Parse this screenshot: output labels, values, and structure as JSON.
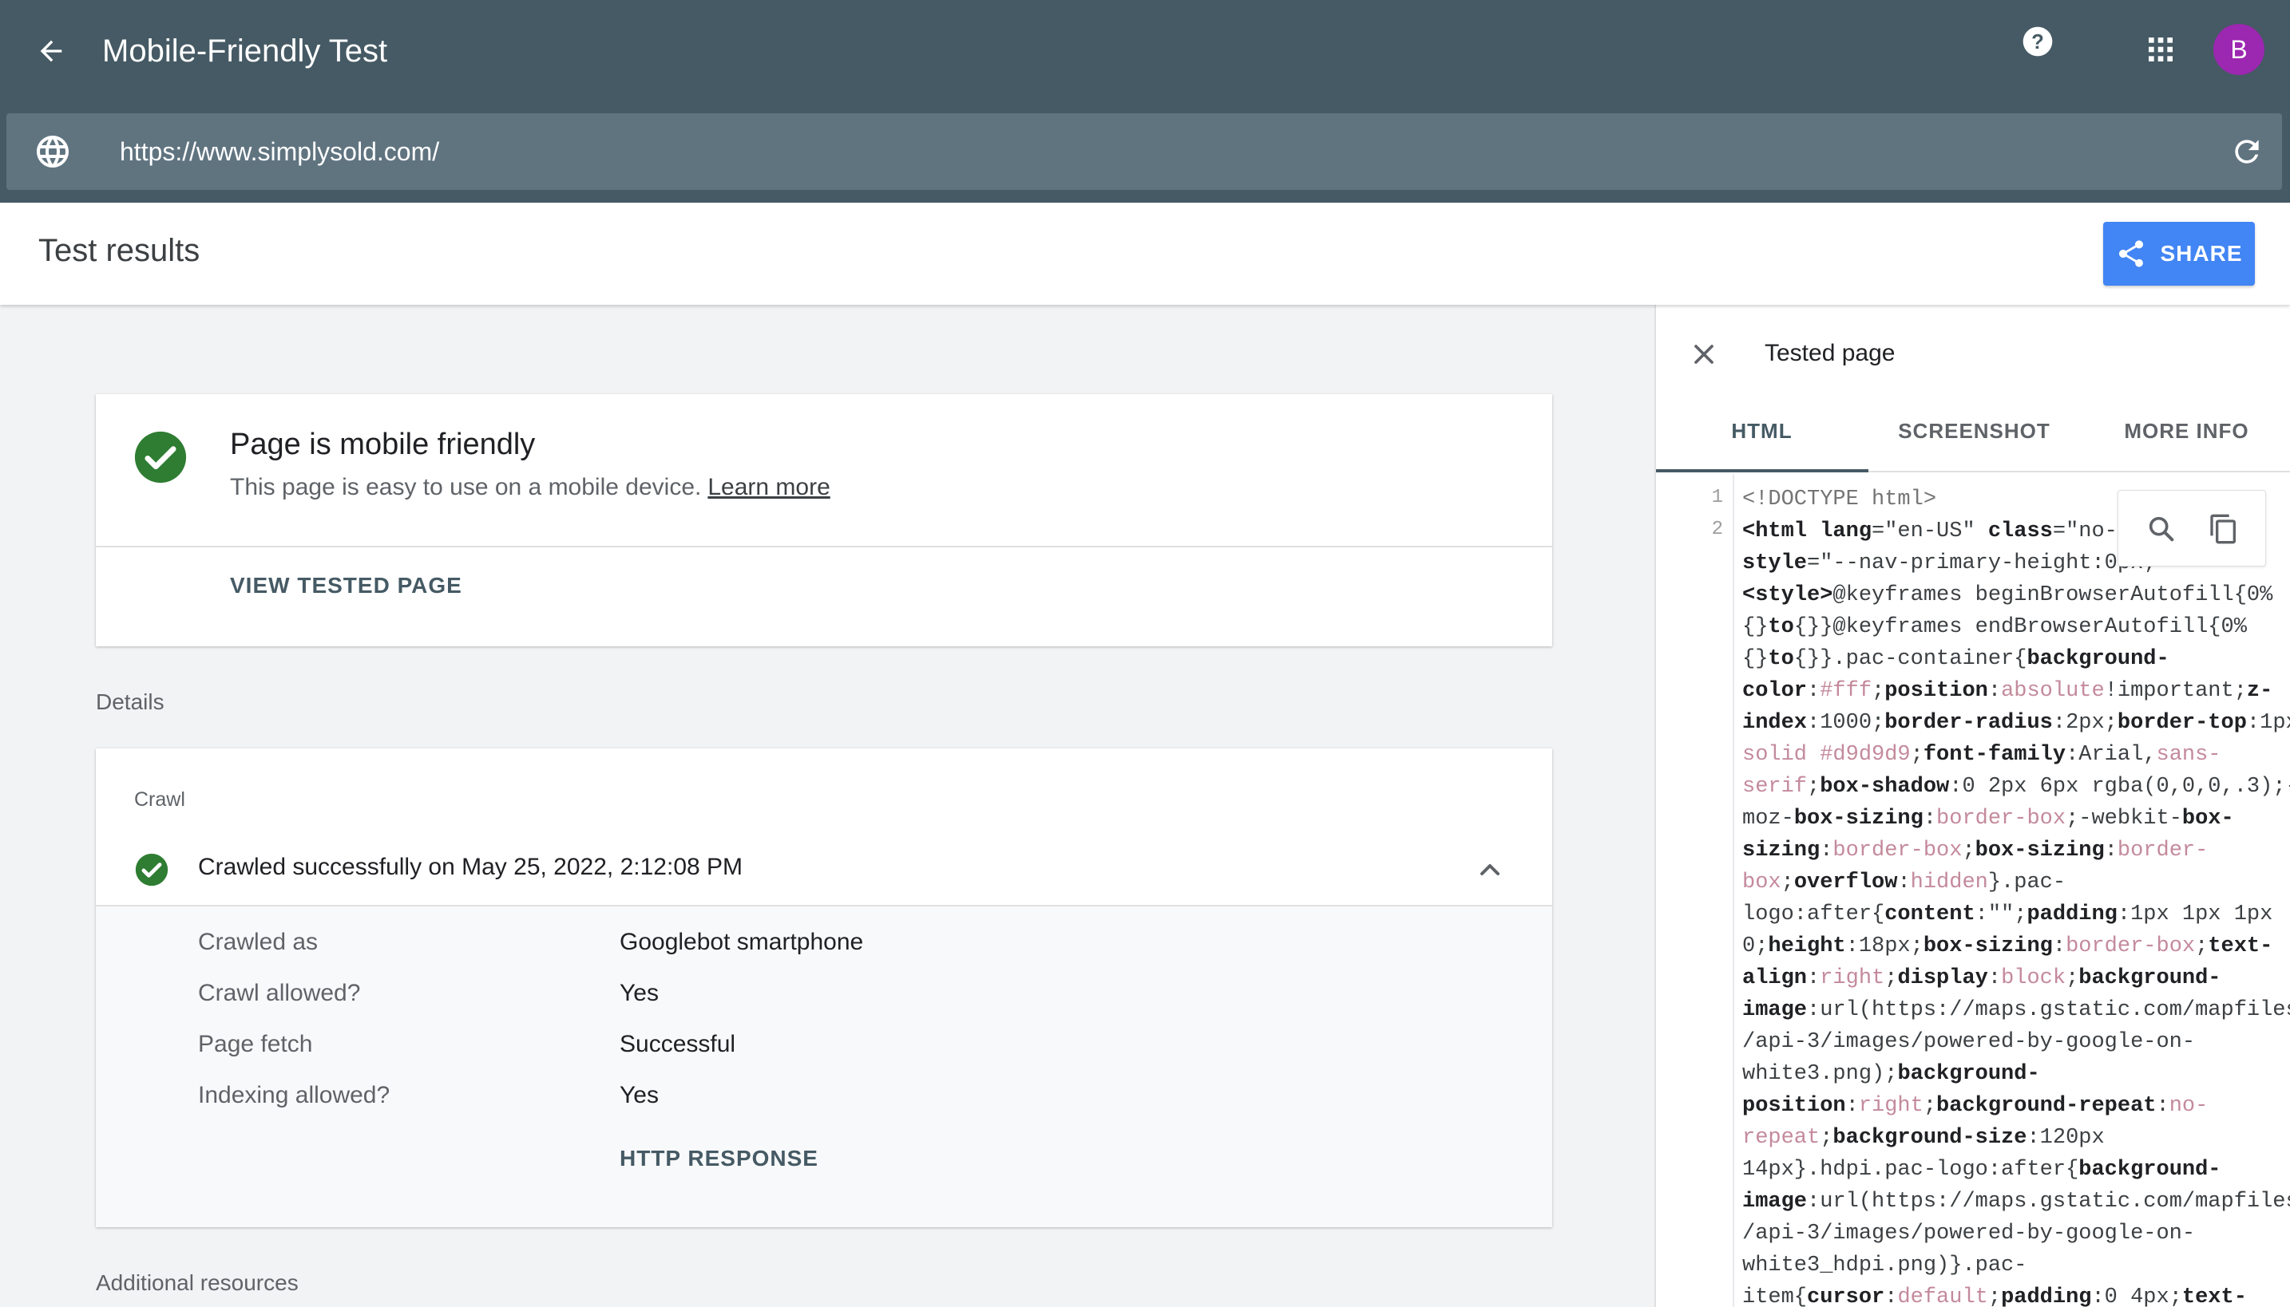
{
  "app": {
    "title": "Mobile-Friendly Test",
    "avatar_letter": "B"
  },
  "url_bar": {
    "value": "https://www.simplysold.com/"
  },
  "results": {
    "title": "Test results",
    "share_label": "SHARE"
  },
  "summary": {
    "title": "Page is mobile friendly",
    "text": "This page is easy to use on a mobile device.",
    "learn_more": "Learn more",
    "view_button": "VIEW TESTED PAGE"
  },
  "details": {
    "label": "Details",
    "crawl_label": "Crawl",
    "crawl_status": "Crawled successfully on May 25, 2022, 2:12:08 PM",
    "rows": [
      {
        "key": "Crawled as",
        "value": "Googlebot smartphone"
      },
      {
        "key": "Crawl allowed?",
        "value": "Yes"
      },
      {
        "key": "Page fetch",
        "value": "Successful"
      },
      {
        "key": "Indexing allowed?",
        "value": "Yes"
      }
    ],
    "http_button": "HTTP RESPONSE"
  },
  "additional": {
    "label": "Additional resources"
  },
  "panel": {
    "title": "Tested page",
    "tabs": [
      "HTML",
      "SCREENSHOT",
      "MORE INFO"
    ],
    "line_numbers": [
      "1",
      "2"
    ],
    "code_line1": "<!DOCTYPE html>"
  },
  "colors": {
    "appbar": "#455a64",
    "url_bar": "#607480",
    "share": "#4285f4",
    "success": "#2e7d32",
    "avatar": "#9c27b0"
  },
  "icons": [
    "back-arrow-icon",
    "help-icon",
    "apps-grid-icon",
    "globe-icon",
    "refresh-icon",
    "share-icon",
    "check-circle-icon",
    "chevron-up-icon",
    "close-icon",
    "search-icon",
    "copy-icon"
  ]
}
